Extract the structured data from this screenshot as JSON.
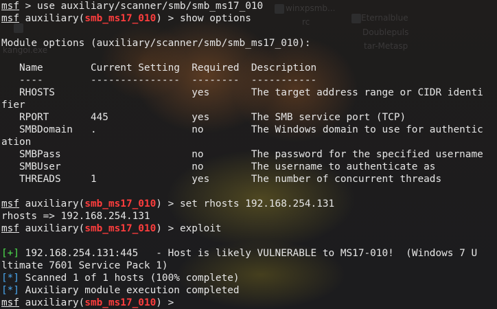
{
  "desktop_background": {
    "icon_labels": [
      "winxpsmb...",
      "rc",
      "Eternalblue",
      "Doublepuls",
      "tar-Metasp",
      "kangoi.exe"
    ]
  },
  "terminal": {
    "prompt_word": "msf",
    "module_prefix": "auxiliary(",
    "module_name": "smb_ms17_010",
    "prompt_suffix": ") > ",
    "first_prompt_tail": " > use auxiliary/scanner/smb/smb_ms17_010",
    "cmd_show": "show options",
    "cmd_set": "set rhosts 192.168.254.131",
    "cmd_exploit": "exploit",
    "module_options_heading": "Module options (auxiliary/scanner/smb/smb_ms17_010):",
    "options_header": "   Name        Current Setting  Required  Description",
    "options_rule": "   ----        ---------------  --------  -----------",
    "options_rows": [
      "   RHOSTS                       yes       The target address range or CIDR identi",
      "fier",
      "   RPORT       445              yes       The SMB service port (TCP)",
      "   SMBDomain   .                no        The Windows domain to use for authentic",
      "ation",
      "   SMBPass                      no        The password for the specified username",
      "   SMBUser                      no        The username to authenticate as",
      "   THREADS     1                yes       The number of concurrent threads"
    ],
    "rhosts_echo": "rhosts => 192.168.254.131",
    "result_plus_tag": "[+]",
    "result_plus_text": " 192.168.254.131:445   - Host is likely VULNERABLE to MS17-010!  (Windows 7 U",
    "result_plus_wrap": "ltimate 7601 Service Pack 1)",
    "result_star_tag": "[*]",
    "scanned_text": " Scanned 1 of 1 hosts (100% complete)",
    "completed_text": " Auxiliary module execution completed"
  },
  "colors": {
    "prompt_module": "#ff3d3d",
    "success_tag": "#4ee04e",
    "info_tag": "#4aa8f0",
    "text": "#e6e6e6"
  }
}
